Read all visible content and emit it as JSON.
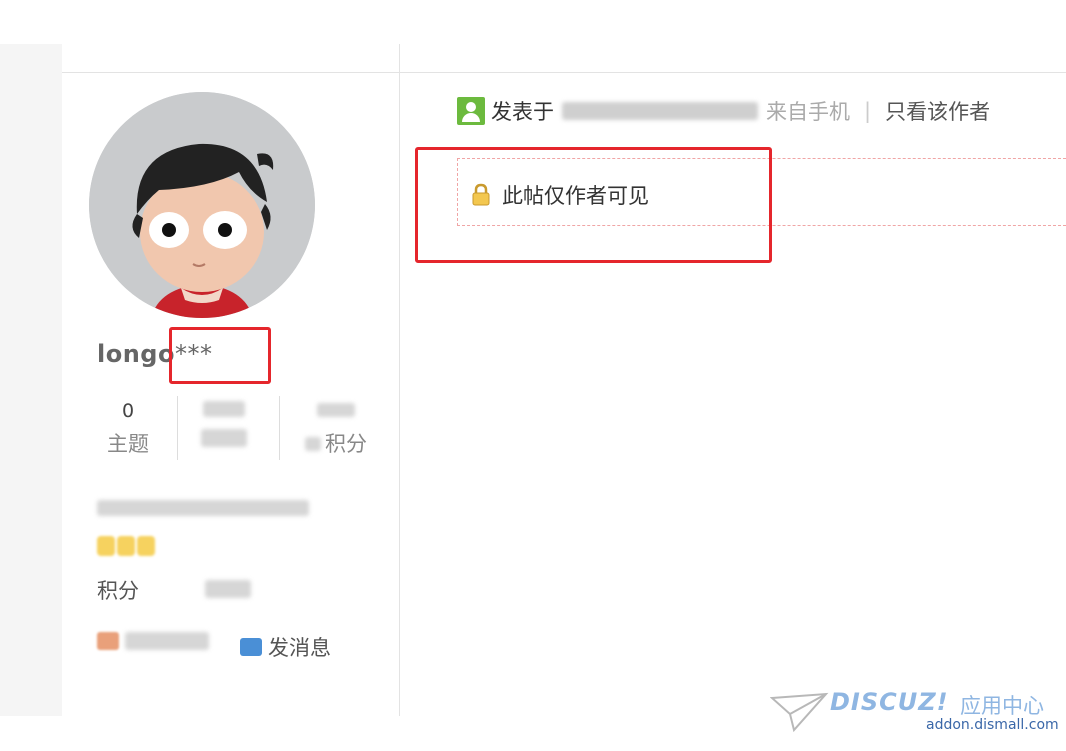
{
  "author": {
    "username_visible": "longo",
    "username_masked": "***",
    "stats": [
      {
        "value": "0",
        "label": "主题"
      },
      {
        "value": "",
        "label": ""
      },
      {
        "value": "",
        "label": "积分"
      }
    ],
    "score_label": "积分",
    "actions": {
      "message_label": "发消息"
    }
  },
  "post": {
    "posted_prefix": "发表于",
    "source": "来自手机",
    "only_author_link": "只看该作者",
    "locked_message": "此帖仅作者可见"
  },
  "watermark": {
    "brand": "DISCUZ!",
    "brand_cn": "应用中心",
    "url": "addon.dismall.com"
  },
  "colors": {
    "highlight_red": "#e5262c",
    "user_icon_green": "#6cba3e",
    "dashed_border": "#f0a5a5",
    "brand_blue": "#3a67a8"
  },
  "icons": {
    "user": "user-icon",
    "lock": "lock-icon",
    "message": "envelope-icon",
    "friend": "add-friend-icon"
  }
}
